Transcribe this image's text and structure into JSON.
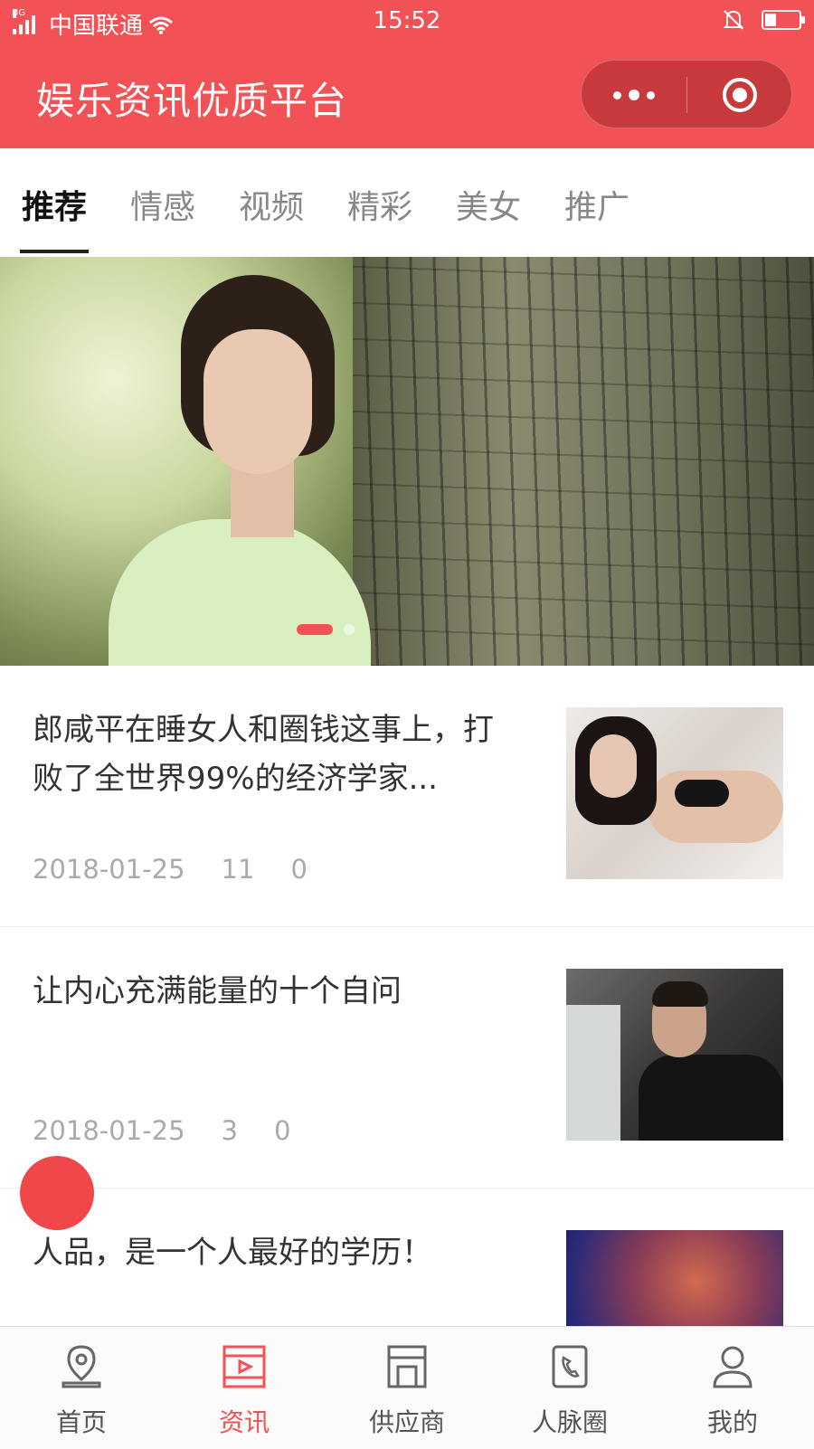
{
  "status_bar": {
    "network": "3G",
    "carrier": "中国联通",
    "time": "15:52"
  },
  "header": {
    "title": "娱乐资讯优质平台"
  },
  "tabs": [
    {
      "label": "推荐",
      "active": true
    },
    {
      "label": "情感",
      "active": false
    },
    {
      "label": "视频",
      "active": false
    },
    {
      "label": "精彩",
      "active": false
    },
    {
      "label": "美女",
      "active": false
    },
    {
      "label": "推广",
      "active": false
    }
  ],
  "banner": {
    "slide_count": 2,
    "current_slide": 1
  },
  "articles": [
    {
      "title": "郎咸平在睡女人和圈钱这事上，打败了全世界99%的经济学家...",
      "date": "2018-01-25",
      "views": "11",
      "comments": "0"
    },
    {
      "title": "让内心充满能量的十个自问",
      "date": "2018-01-25",
      "views": "3",
      "comments": "0"
    },
    {
      "title": "人品，是一个人最好的学历！",
      "date": "",
      "views": "",
      "comments": ""
    }
  ],
  "bottom_nav": [
    {
      "label": "首页",
      "icon": "location-pin-icon",
      "active": false
    },
    {
      "label": "资讯",
      "icon": "video-play-icon",
      "active": true
    },
    {
      "label": "供应商",
      "icon": "store-icon",
      "active": false
    },
    {
      "label": "人脉圈",
      "icon": "contacts-phone-icon",
      "active": false
    },
    {
      "label": "我的",
      "icon": "user-icon",
      "active": false
    }
  ],
  "colors": {
    "brand": "#f25255",
    "capsule": "#c8393c",
    "active_tab_text": "#111111",
    "meta_text": "#aaaaaa"
  }
}
